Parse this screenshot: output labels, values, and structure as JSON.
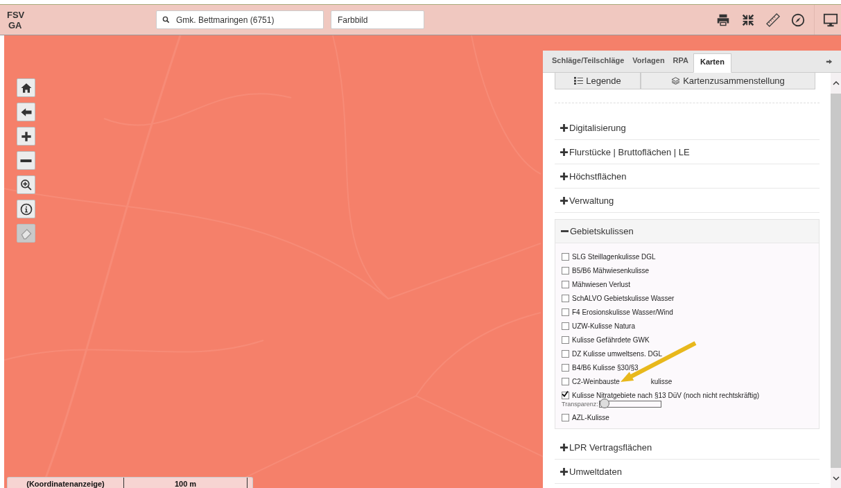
{
  "header": {
    "logo": [
      "FSV",
      "GA"
    ],
    "search": {
      "value": "Gmk. Bettmaringen (6751)"
    },
    "layer_field": {
      "value": "Farbbild"
    }
  },
  "map_tools": [
    {
      "kind": "home",
      "disabled": false
    },
    {
      "kind": "back",
      "disabled": false
    },
    {
      "kind": "zoom-in",
      "disabled": false
    },
    {
      "kind": "zoom-out",
      "disabled": false
    },
    {
      "kind": "zoom-box",
      "disabled": false
    },
    {
      "kind": "info",
      "disabled": false
    },
    {
      "kind": "eraser",
      "disabled": true
    }
  ],
  "scale_bar": {
    "coordinates": "(Koordinatenanzeige)",
    "scale": "100 m"
  },
  "panel": {
    "tabs": [
      {
        "label": "Schläge/Teilschläge",
        "selected": false
      },
      {
        "label": "Vorlagen",
        "selected": false
      },
      {
        "label": "RPA",
        "selected": false
      },
      {
        "label": "Karten",
        "selected": true
      }
    ],
    "subtabs": [
      {
        "label": "Legende",
        "kind": "list"
      },
      {
        "label": "Kartenzusammenstellung",
        "kind": "layers"
      }
    ],
    "sections": [
      {
        "title": "Digitalisierung",
        "expanded": false
      },
      {
        "title": "Flurstücke | Bruttoflächen | LE",
        "expanded": false
      },
      {
        "title": "Höchstflächen",
        "expanded": false
      },
      {
        "title": "Verwaltung",
        "expanded": false
      },
      {
        "title": "Gebietskulissen",
        "expanded": true,
        "layers": [
          {
            "label": "SLG Steillagenkulisse DGL",
            "checked": false
          },
          {
            "label": "B5/B6 Mähwiesenkulisse",
            "checked": false
          },
          {
            "label": "Mähwiesen Verlust",
            "checked": false
          },
          {
            "label": "SchALVO Gebietskulisse Wasser",
            "checked": false
          },
          {
            "label": "F4 Erosionskulisse Wasser/Wind",
            "checked": false
          },
          {
            "label": "UZW-Kulisse Natura",
            "checked": false
          },
          {
            "label": "Kulisse Gefährdete GWK",
            "checked": false
          },
          {
            "label": "DZ Kulisse umweltsens. DGL",
            "checked": false
          },
          {
            "label": "B4/B6 Kulisse §30/§3",
            "checked": false
          },
          {
            "label": "C2-Weinbauste",
            "label_after": "kulisse",
            "checked": false
          },
          {
            "label": "Kulisse Nitratgebiete nach §13 DüV (noch nicht rechtskräftig)",
            "checked": true,
            "slider": {
              "label": "Transparenz:",
              "level": 0
            }
          },
          {
            "label": "AZL-Kulisse",
            "checked": false
          }
        ]
      },
      {
        "title": "LPR Vertragsflächen",
        "expanded": false
      },
      {
        "title": "Umweltdaten",
        "expanded": false
      }
    ]
  }
}
